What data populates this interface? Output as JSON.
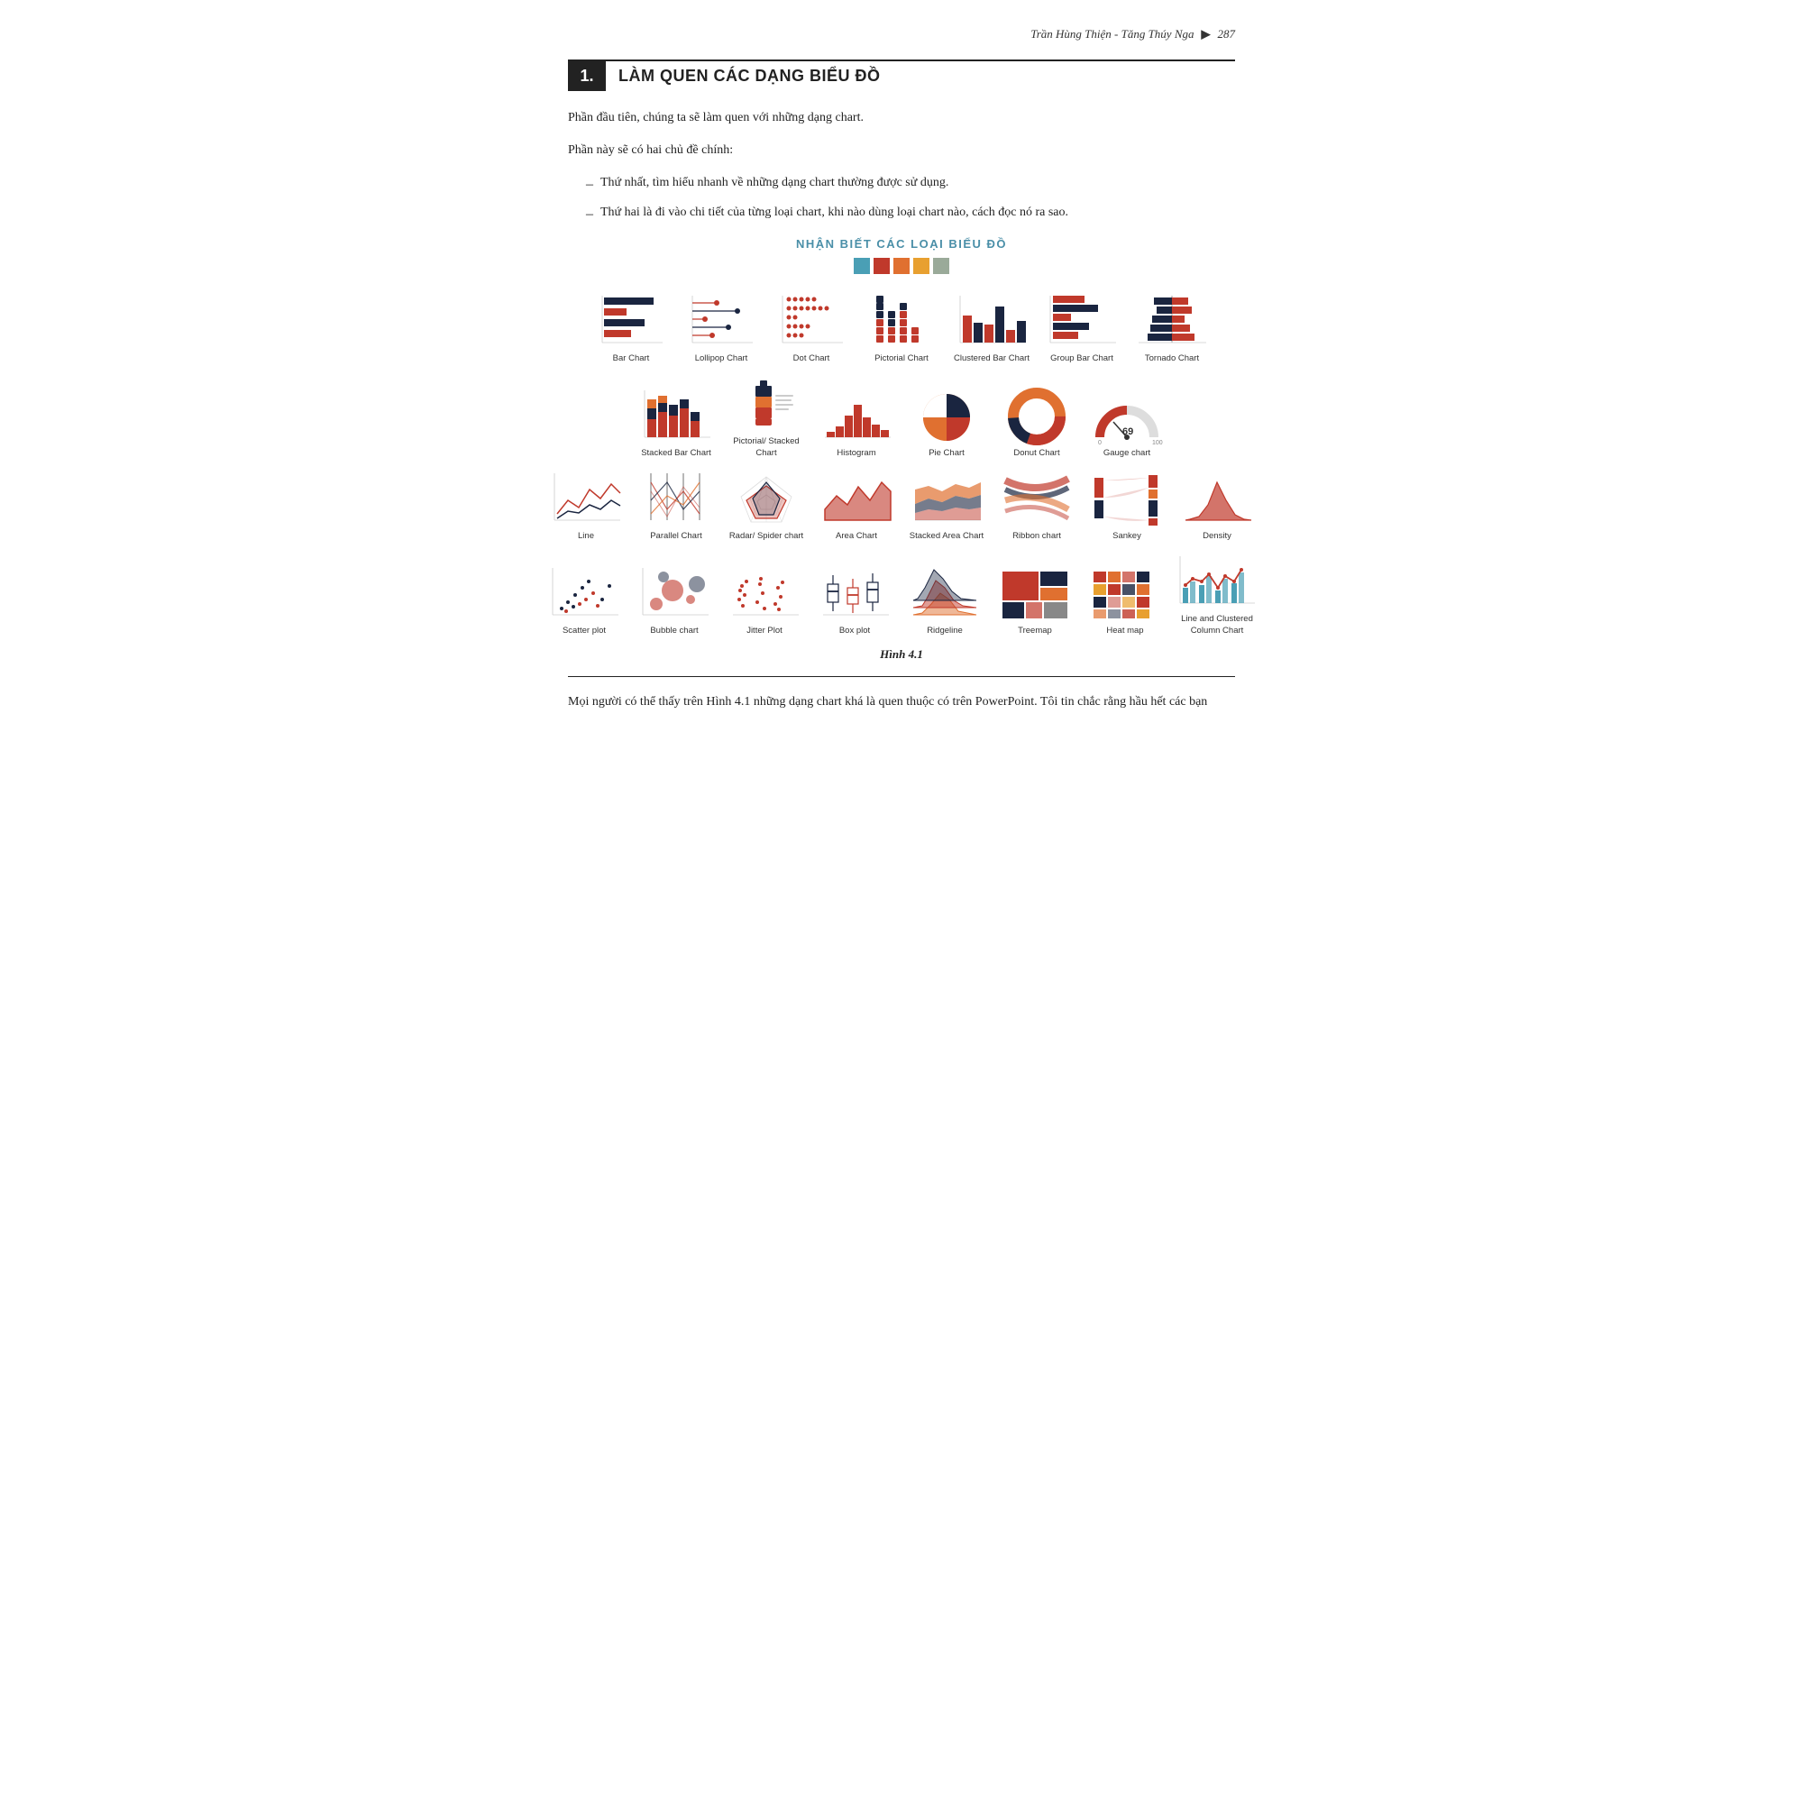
{
  "header": {
    "author": "Trần Hùng Thiện - Tăng Thúy Nga",
    "page": "287",
    "arrow": "▶"
  },
  "section": {
    "number": "1.",
    "title": "LÀM QUEN CÁC DẠNG BIỂU ĐỒ"
  },
  "paragraphs": [
    "Phần đầu tiên, chúng ta sẽ làm quen với những dạng chart.",
    "Phần này sẽ có hai chủ đề chính:"
  ],
  "bullets": [
    "Thứ nhất, tìm hiểu nhanh về những dạng chart thường được sử dụng.",
    "Thứ hai là đi vào chi tiết của từng loại chart, khi nào dùng loại chart nào, cách đọc nó ra sao."
  ],
  "chart_section": {
    "title": "NHẬN BIẾT CÁC LOẠI BIỂU ĐỒ",
    "swatches": [
      "#4a9fb5",
      "#c0392b",
      "#e07030",
      "#e8a030",
      "#9aaa99"
    ],
    "rows": [
      [
        {
          "label": "Bar Chart"
        },
        {
          "label": "Lollipop Chart"
        },
        {
          "label": "Dot Chart"
        },
        {
          "label": "Pictorial Chart"
        },
        {
          "label": "Clustered Bar Chart"
        },
        {
          "label": "Group Bar Chart"
        },
        {
          "label": "Tornado Chart"
        }
      ],
      [
        {
          "label": "Stacked Bar Chart"
        },
        {
          "label": "Pictorial/ Stacked Chart"
        },
        {
          "label": "Histogram"
        },
        {
          "label": "Pie Chart"
        },
        {
          "label": "Donut Chart"
        },
        {
          "label": "Gauge chart"
        }
      ],
      [
        {
          "label": "Line"
        },
        {
          "label": "Parallel Chart"
        },
        {
          "label": "Radar/ Spider chart"
        },
        {
          "label": "Area Chart"
        },
        {
          "label": "Stacked Area Chart"
        },
        {
          "label": "Ribbon chart"
        },
        {
          "label": "Sankey"
        },
        {
          "label": "Density"
        }
      ],
      [
        {
          "label": "Scatter plot"
        },
        {
          "label": "Bubble chart"
        },
        {
          "label": "Jitter Plot"
        },
        {
          "label": "Box plot"
        },
        {
          "label": "Ridgeline"
        },
        {
          "label": "Treemap"
        },
        {
          "label": "Heat map"
        },
        {
          "label": "Line and Clustered Column Chart"
        }
      ]
    ]
  },
  "figure_caption": "Hình 4.1",
  "footer_text": "Mọi người có thể thấy trên Hình 4.1 những dạng chart khá là quen thuộc có trên PowerPoint. Tôi tin chắc rằng hầu hết các bạn"
}
